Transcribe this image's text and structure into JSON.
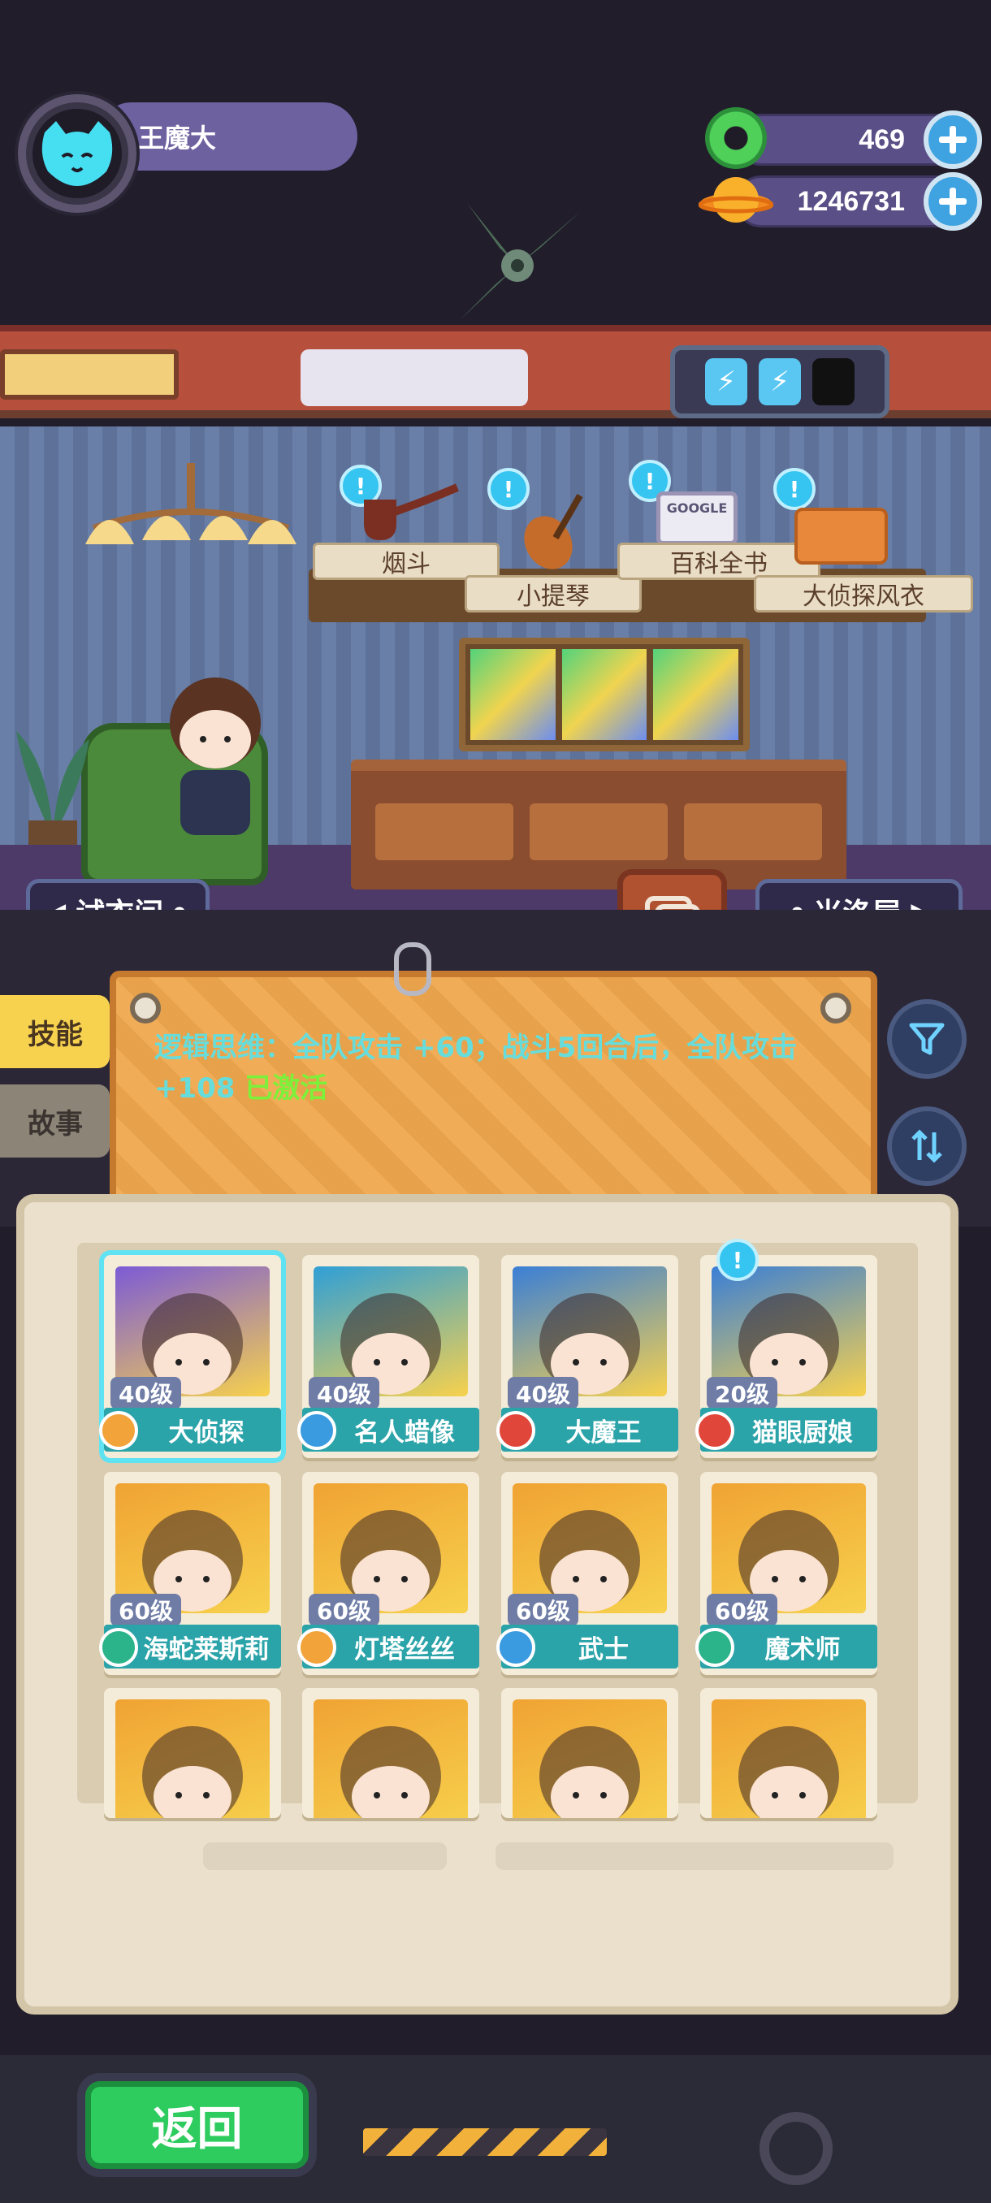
{
  "player": {
    "name": "王魔大"
  },
  "currency": {
    "gems": {
      "value": "469",
      "icon": "green-donut-icon"
    },
    "coins": {
      "value": "1246731",
      "icon": "gold-planet-icon"
    }
  },
  "items": [
    {
      "label": "烟斗",
      "icon": "pipe-icon"
    },
    {
      "label": "小提琴",
      "icon": "violin-icon"
    },
    {
      "label": "百科全书",
      "icon": "encyclopedia-icon",
      "cover": "GOOGLE"
    },
    {
      "label": "大侦探风衣",
      "icon": "trenchcoat-icon"
    }
  ],
  "nav": {
    "left": "试衣间",
    "right": "米洛屋"
  },
  "side_tabs": {
    "skill": "技能",
    "story": "故事"
  },
  "skill": {
    "text": "逻辑思维：全队攻击 +60；战斗5回合后，全队攻击 +108",
    "status": "已激活"
  },
  "characters": [
    {
      "level": "40级",
      "name": "大侦探",
      "class_color": "#f2a43a",
      "bg": "#7c5bd6",
      "selected": true
    },
    {
      "level": "40级",
      "name": "名人蜡像",
      "class_color": "#3a9be0",
      "bg": "#2f9fd6"
    },
    {
      "level": "40级",
      "name": "大魔王",
      "class_color": "#e0473a",
      "bg": "#3a7fd6"
    },
    {
      "level": "20级",
      "name": "猫眼厨娘",
      "class_color": "#e0473a",
      "bg": "#3a7fd6",
      "badge": true
    },
    {
      "level": "60级",
      "name": "海蛇莱斯莉",
      "class_color": "#2bb38a",
      "bg": "#f0a333"
    },
    {
      "level": "60级",
      "name": "灯塔丝丝",
      "class_color": "#f2a43a",
      "bg": "#f0a333"
    },
    {
      "level": "60级",
      "name": "武士",
      "class_color": "#3a9be0",
      "bg": "#f0a333"
    },
    {
      "level": "60级",
      "name": "魔术师",
      "class_color": "#2bb38a",
      "bg": "#f0a333"
    },
    {
      "bg": "#f0a333"
    },
    {
      "bg": "#f0a333"
    },
    {
      "bg": "#f0a333"
    },
    {
      "bg": "#f0a333"
    }
  ],
  "back_button": "返回"
}
